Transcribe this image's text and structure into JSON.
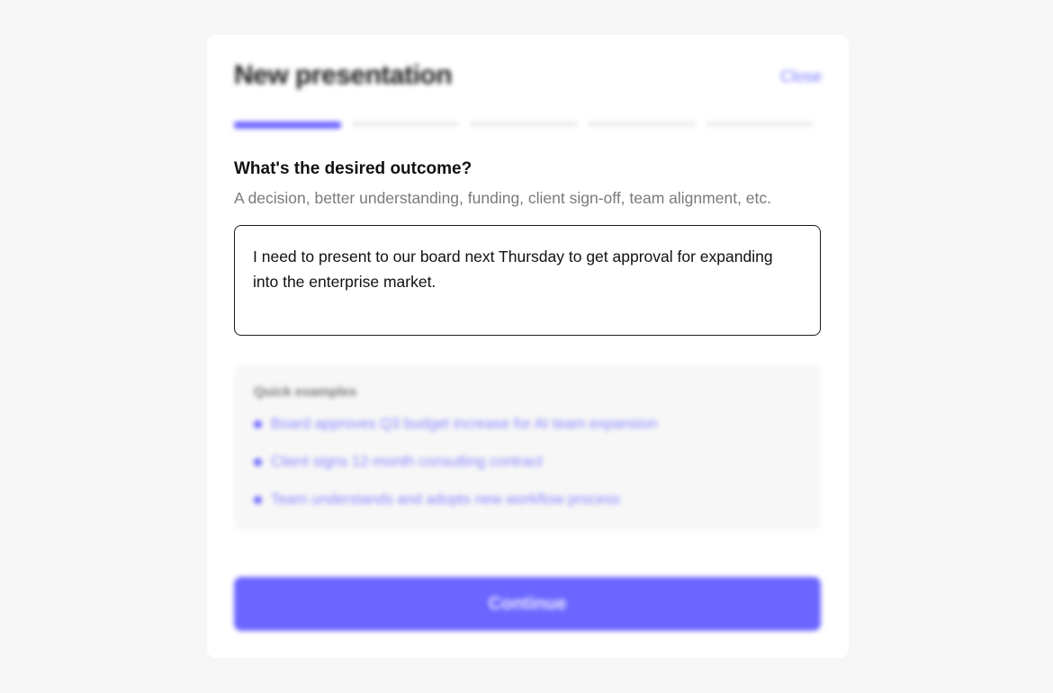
{
  "header": {
    "title": "New presentation",
    "close_label": "Close"
  },
  "progress": {
    "current_step": 1,
    "total_steps": 5
  },
  "question": {
    "label": "What's the desired outcome?",
    "hint": "A decision, better understanding, funding, client sign-off, team alignment, etc.",
    "answer": "I need to present to our board next Thursday to get approval for expanding into the enterprise market."
  },
  "examples": {
    "title": "Quick examples",
    "items": [
      "Board approves Q3 budget increase for AI team expansion",
      "Client signs 12-month consulting contract",
      "Team understands and adopts new workflow process"
    ]
  },
  "footer": {
    "continue_label": "Continue"
  },
  "colors": {
    "accent": "#6b66ff",
    "background": "#f6f6f6"
  }
}
